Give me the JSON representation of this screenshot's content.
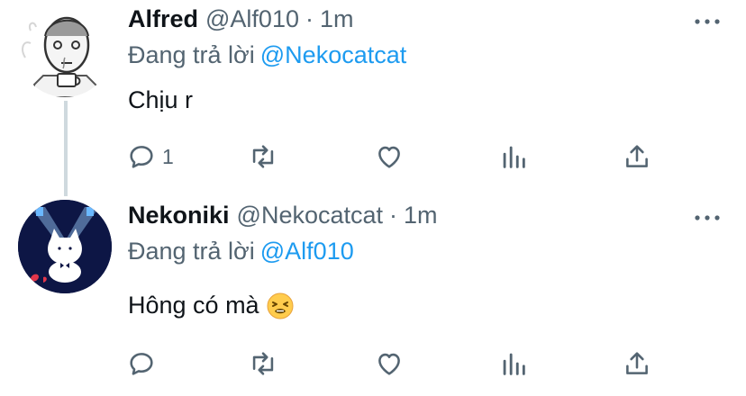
{
  "colors": {
    "text": "#0f1419",
    "secondary": "#536471",
    "link": "#1d9bf0",
    "thread_line": "#cfd9de"
  },
  "tweets": [
    {
      "name": "Alfred",
      "handle": "@Alf010",
      "separator": "·",
      "time": "1m",
      "replying_prefix": "Đang trả lời",
      "replying_to": "@Nekocatcat",
      "text": "Chịu r",
      "reply_count": "1",
      "avatar_icon": "sketch-man-with-cup-avatar"
    },
    {
      "name": "Nekoniki",
      "handle": "@Nekocatcat",
      "separator": "·",
      "time": "1m",
      "replying_prefix": "Đang trả lời",
      "replying_to": "@Alf010",
      "text": "Hông có mà",
      "emoji": "tired-face-emoji",
      "reply_count": "",
      "avatar_icon": "white-cat-spotlight-avatar"
    }
  ],
  "icons": {
    "reply": "reply-icon",
    "retweet": "retweet-icon",
    "like": "heart-icon",
    "analytics": "analytics-icon",
    "share": "share-icon",
    "more": "more-icon"
  }
}
